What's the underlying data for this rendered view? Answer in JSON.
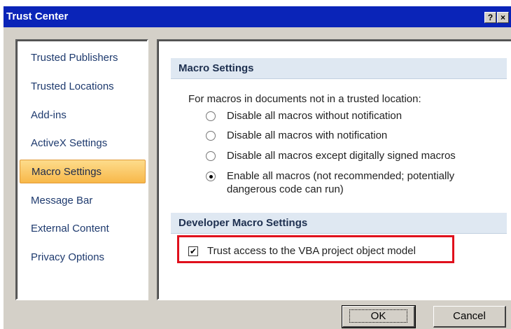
{
  "window": {
    "title": "Trust Center",
    "help_glyph": "?",
    "close_glyph": "×"
  },
  "nav": [
    {
      "label": "Trusted Publishers",
      "selected": false
    },
    {
      "label": "Trusted Locations",
      "selected": false
    },
    {
      "label": "Add-ins",
      "selected": false
    },
    {
      "label": "ActiveX Settings",
      "selected": false
    },
    {
      "label": "Macro Settings",
      "selected": true
    },
    {
      "label": "Message Bar",
      "selected": false
    },
    {
      "label": "External Content",
      "selected": false
    },
    {
      "label": "Privacy Options",
      "selected": false
    }
  ],
  "macro": {
    "header": "Macro Settings",
    "description": "For macros in documents not in a trusted location:",
    "options": [
      {
        "label": "Disable all macros without notification",
        "checked": false
      },
      {
        "label": "Disable all macros with notification",
        "checked": false
      },
      {
        "label": "Disable all macros except digitally signed macros",
        "checked": false
      },
      {
        "label": "Enable all macros (not recommended; potentially",
        "label2": "dangerous code can run)",
        "checked": true
      }
    ]
  },
  "developer": {
    "header": "Developer Macro Settings",
    "checkbox_label": "Trust access to the VBA project object model",
    "checked": true,
    "check_glyph": "✔"
  },
  "buttons": {
    "ok": "OK",
    "cancel": "Cancel"
  },
  "colors": {
    "title_bar": "#0a24b8",
    "selected_nav": "#f8b84a",
    "highlight_box": "#e0101c",
    "section_header": "#dfe8f2"
  }
}
